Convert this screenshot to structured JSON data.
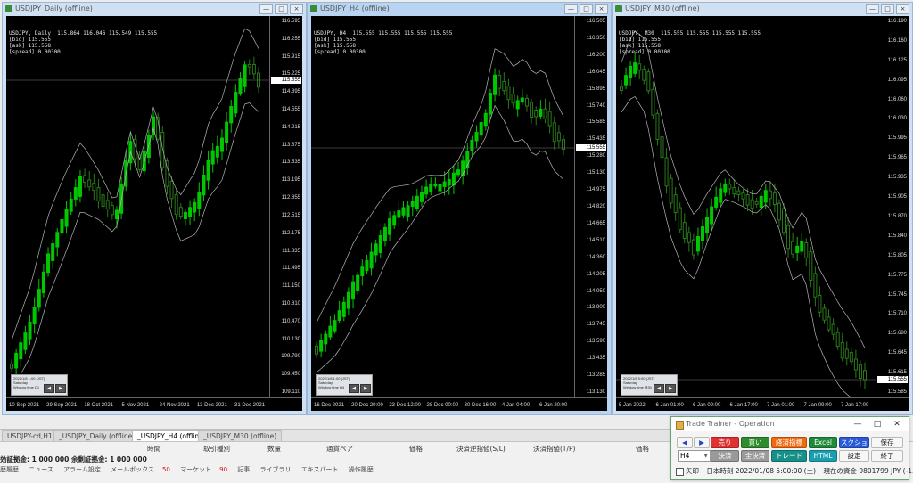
{
  "colors": {
    "bull": "#00c800",
    "bear": "#2a7a1a",
    "band": "#b4b4b4"
  },
  "windows": [
    {
      "title": "USDJPY_Daily (offline)",
      "info": [
        "USDJPY, Daily  115.864 116.046 115.549 115.555",
        "[bid] 115.555",
        "[ask] 115.558",
        "[spread] 0.00300"
      ],
      "yticks": [
        "116.595",
        "116.255",
        "115.915",
        "115.225",
        "114.895",
        "114.555",
        "114.215",
        "113.875",
        "113.535",
        "113.195",
        "112.855",
        "112.515",
        "112.175",
        "111.835",
        "111.495",
        "111.150",
        "110.810",
        "110.470",
        "110.130",
        "109.790",
        "109.450",
        "109.110"
      ],
      "price": "115.555",
      "xticks": [
        "10 Sep 2021",
        "29 Sep 2021",
        "18 Oct 2021",
        "5 Nov 2021",
        "24 Nov 2021",
        "13 Dec 2021",
        "31 Dec 2021"
      ],
      "mini": [
        "2022/1/8 1:00 (JST)",
        "Saturday",
        "Window time   D1"
      ]
    },
    {
      "title": "USDJPY_H4 (offline)",
      "info": [
        "USDJPY, H4  115.555 115.555 115.555 115.555",
        "[bid] 115.555",
        "[ask] 115.558",
        "[spread] 0.00300"
      ],
      "yticks": [
        "116.505",
        "116.350",
        "116.200",
        "116.045",
        "115.895",
        "115.740",
        "115.585",
        "115.435",
        "115.280",
        "115.130",
        "114.975",
        "114.820",
        "114.665",
        "114.510",
        "114.360",
        "114.205",
        "114.050",
        "113.900",
        "113.745",
        "113.590",
        "113.435",
        "113.285",
        "113.130"
      ],
      "price": "115.555",
      "xticks": [
        "16 Dec 2021",
        "20 Dec 20:00",
        "23 Dec 12:00",
        "28 Dec 00:00",
        "30 Dec 16:00",
        "4 Jan 04:00",
        "6 Jan 20:00"
      ],
      "mini": [
        "2022/1/8 1:00 (JST)",
        "Saturday",
        "Window time   H4"
      ]
    },
    {
      "title": "USDJPY_M30 (offline)",
      "info": [
        "USDJPY, M30  115.555 115.555 115.555 115.555",
        "[bid] 115.555",
        "[ask] 115.558",
        "[spread] 0.00300"
      ],
      "yticks": [
        "116.190",
        "116.160",
        "116.125",
        "116.095",
        "116.060",
        "116.030",
        "115.995",
        "115.965",
        "115.935",
        "115.905",
        "115.870",
        "115.840",
        "115.805",
        "115.775",
        "115.745",
        "115.710",
        "115.680",
        "115.645",
        "115.615",
        "115.585"
      ],
      "price": "115.555",
      "xticks": [
        "5 Jan 2022",
        "6 Jan 01:00",
        "6 Jan 09:00",
        "6 Jan 17:00",
        "7 Jan 01:00",
        "7 Jan 09:00",
        "7 Jan 17:00"
      ],
      "mini": [
        "2022/1/8 5:00 (JST)",
        "Saturday",
        "Window time   M30"
      ]
    }
  ],
  "tabs": [
    "USDJPY-cd,H1",
    "_USDJPY_Daily (offline)",
    "_USDJPY_H4 (offline)",
    "_USDJPY_M30 (offline)"
  ],
  "terminal": {
    "headers": [
      "時間",
      "取引種別",
      "数量",
      "通貨ペア",
      "価格",
      "決済逆指値(S/L)",
      "決済指値(T/P)",
      "価格"
    ],
    "balance": "効証拠金: 1 000 000  余剰証拠金: 1 000 000",
    "tabs": [
      "歴履歴",
      "ニュース",
      "アラーム設定",
      "メールボックス",
      "マーケット",
      "記事",
      "ライブラリ",
      "エキスパート",
      "操作履歴"
    ],
    "mail_count": "50",
    "market_count": "90"
  },
  "trade_trainer": {
    "title": "Trade Trainer - Operation",
    "row1": [
      "◀",
      "▶",
      "売り",
      "買い",
      "経済指標",
      "Excel",
      "スクショ",
      "保存"
    ],
    "row2": [
      "決済",
      "全決済",
      "トレード",
      "HTML",
      "設定",
      "終了"
    ],
    "timeframe": "H4",
    "arrow_label": "矢印",
    "time_label": "日本時刻 2022/01/08 5:00:00 (土)",
    "balance_label": "現在の資金 9801799 JPY (-1.98%)"
  }
}
